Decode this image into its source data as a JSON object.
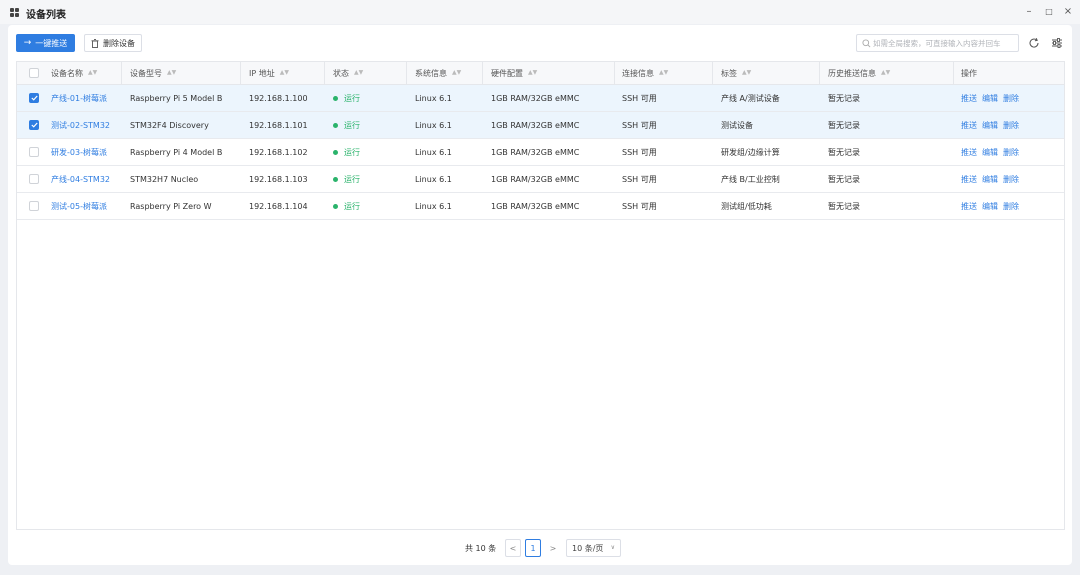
{
  "window": {
    "title": "设备列表",
    "controls": [
      "–",
      "□",
      "×"
    ]
  },
  "toolbar": {
    "push_label": "一键推送",
    "delete_label": "删除设备",
    "search_placeholder": "如需全局搜索，可直接输入内容并回车"
  },
  "table": {
    "headers": [
      "设备名称",
      "设备型号",
      "IP 地址",
      "状态",
      "系统信息",
      "硬件配置",
      "连接信息",
      "标签",
      "历史推送信息",
      "操作"
    ],
    "rows": [
      {
        "selected": true,
        "name": "产线-01-树莓派",
        "model": "Raspberry Pi 5 Model B",
        "ip": "192.168.1.100",
        "status": "运行",
        "os": "Linux 6.1",
        "hw": "1GB RAM/32GB eMMC",
        "conn": "SSH 可用",
        "tag": "产线 A/测试设备",
        "history": "暂无记录"
      },
      {
        "selected": true,
        "name": "测试-02-STM32",
        "model": "STM32F4 Discovery",
        "ip": "192.168.1.101",
        "status": "运行",
        "os": "Linux 6.1",
        "hw": "1GB RAM/32GB eMMC",
        "conn": "SSH 可用",
        "tag": "测试设备",
        "history": "暂无记录"
      },
      {
        "selected": false,
        "name": "研发-03-树莓派",
        "model": "Raspberry Pi 4 Model B",
        "ip": "192.168.1.102",
        "status": "运行",
        "os": "Linux 6.1",
        "hw": "1GB RAM/32GB eMMC",
        "conn": "SSH 可用",
        "tag": "研发组/边缘计算",
        "history": "暂无记录"
      },
      {
        "selected": false,
        "name": "产线-04-STM32",
        "model": "STM32H7 Nucleo",
        "ip": "192.168.1.103",
        "status": "运行",
        "os": "Linux 6.1",
        "hw": "1GB RAM/32GB eMMC",
        "conn": "SSH 可用",
        "tag": "产线 B/工业控制",
        "history": "暂无记录"
      },
      {
        "selected": false,
        "name": "测试-05-树莓派",
        "model": "Raspberry Pi Zero W",
        "ip": "192.168.1.104",
        "status": "运行",
        "os": "Linux 6.1",
        "hw": "1GB RAM/32GB eMMC",
        "conn": "SSH 可用",
        "tag": "测试组/低功耗",
        "history": "暂无记录"
      }
    ],
    "actions": [
      "推送",
      "编辑",
      "删除"
    ]
  },
  "pagination": {
    "total": "共 10 条",
    "prev": "<",
    "current": "1",
    "next": ">",
    "page_size": "10 条/页"
  },
  "colors": {
    "accent": "#2f7de1",
    "status_running": "#2ab36b",
    "selected_row": "#ecf5fd"
  }
}
